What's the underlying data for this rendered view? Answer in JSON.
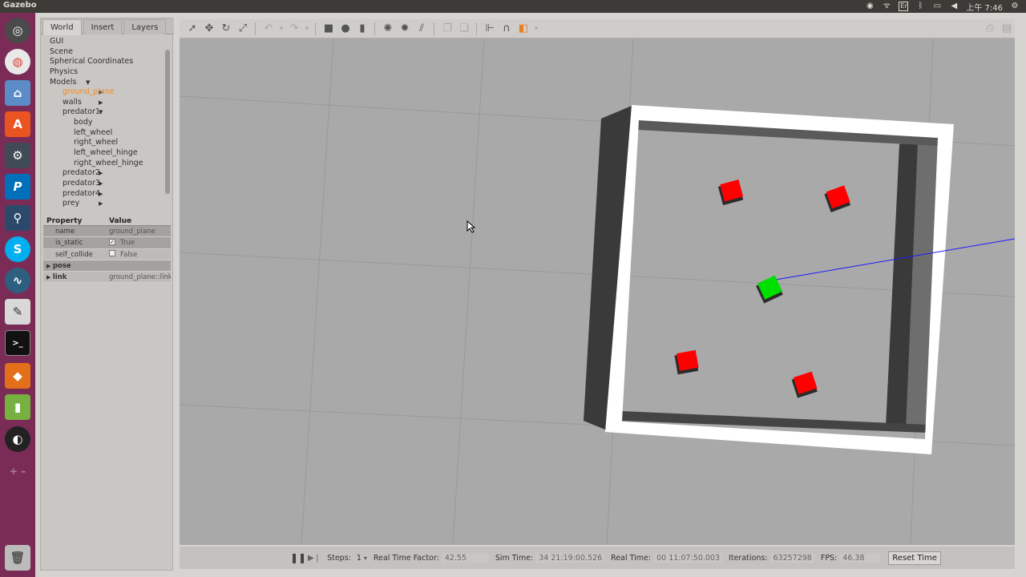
{
  "topbar": {
    "app_title": "Gazebo",
    "keyboard_indicator": "En",
    "clock": "上午 7:46"
  },
  "panel": {
    "tabs": [
      "World",
      "Insert",
      "Layers"
    ],
    "tree": [
      {
        "label": "GUI",
        "indent": 0,
        "arrow": "",
        "selected": false
      },
      {
        "label": "Scene",
        "indent": 0,
        "arrow": "",
        "selected": false
      },
      {
        "label": "Spherical Coordinates",
        "indent": 0,
        "arrow": "",
        "selected": false
      },
      {
        "label": "Physics",
        "indent": 0,
        "arrow": "",
        "selected": false
      },
      {
        "label": "Models",
        "indent": 0,
        "arrow": "down",
        "selected": false
      },
      {
        "label": "ground_plane",
        "indent": 1,
        "arrow": "right",
        "selected": true
      },
      {
        "label": "walls",
        "indent": 1,
        "arrow": "right",
        "selected": false
      },
      {
        "label": "predator1",
        "indent": 1,
        "arrow": "down",
        "selected": false
      },
      {
        "label": "body",
        "indent": 2,
        "arrow": "",
        "selected": false
      },
      {
        "label": "left_wheel",
        "indent": 2,
        "arrow": "",
        "selected": false
      },
      {
        "label": "right_wheel",
        "indent": 2,
        "arrow": "",
        "selected": false
      },
      {
        "label": "left_wheel_hinge",
        "indent": 2,
        "arrow": "",
        "selected": false
      },
      {
        "label": "right_wheel_hinge",
        "indent": 2,
        "arrow": "",
        "selected": false
      },
      {
        "label": "predator2",
        "indent": 1,
        "arrow": "right",
        "selected": false
      },
      {
        "label": "predator3",
        "indent": 1,
        "arrow": "right",
        "selected": false
      },
      {
        "label": "predator4",
        "indent": 1,
        "arrow": "right",
        "selected": false
      },
      {
        "label": "prey",
        "indent": 1,
        "arrow": "right",
        "selected": false
      }
    ],
    "props_header": {
      "property": "Property",
      "value": "Value"
    },
    "props": [
      {
        "key": "name",
        "value": "ground_plane",
        "type": "text",
        "dark": true
      },
      {
        "key": "is_static",
        "value": "True",
        "type": "check",
        "checked": true,
        "dark": true
      },
      {
        "key": "self_collide",
        "value": "False",
        "type": "check",
        "checked": false,
        "dark": false
      },
      {
        "key": "pose",
        "value": "",
        "type": "expand",
        "dark": true
      },
      {
        "key": "link",
        "value": "ground_plane::link",
        "type": "expand",
        "dark": false
      }
    ]
  },
  "statusbar": {
    "steps_label": "Steps:",
    "steps_value": "1",
    "rtf_label": "Real Time Factor:",
    "rtf_value": "42.55",
    "sim_time_label": "Sim Time:",
    "sim_time_value": "34 21:19:00.526",
    "real_time_label": "Real Time:",
    "real_time_value": "00 11:07:50.003",
    "iterations_label": "Iterations:",
    "iterations_value": "63257298",
    "fps_label": "FPS:",
    "fps_value": "46.38",
    "reset_label": "Reset Time"
  },
  "scene": {
    "ground_color": "#a9a9a9",
    "wall_top_color": "#ffffff",
    "wall_side_color": "#3a3a3a",
    "predator_color": "#ff0000",
    "prey_color": "#00e000",
    "ray_color": "#1a1aff"
  }
}
